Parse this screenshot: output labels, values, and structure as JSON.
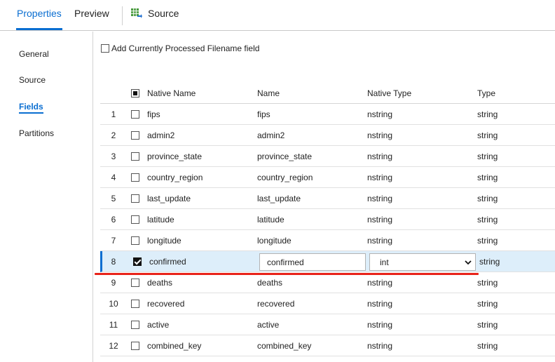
{
  "tabs": {
    "properties": "Properties",
    "preview": "Preview",
    "source": "Source"
  },
  "nav": {
    "general": "General",
    "source": "Source",
    "fields": "Fields",
    "partitions": "Partitions"
  },
  "add_filename_label": "Add Currently Processed Filename field",
  "columns": {
    "native_name": "Native Name",
    "name": "Name",
    "native_type": "Native Type",
    "type": "Type"
  },
  "rows": [
    {
      "num": "1",
      "native_name": "fips",
      "name": "fips",
      "native_type": "nstring",
      "type": "string"
    },
    {
      "num": "2",
      "native_name": "admin2",
      "name": "admin2",
      "native_type": "nstring",
      "type": "string"
    },
    {
      "num": "3",
      "native_name": "province_state",
      "name": "province_state",
      "native_type": "nstring",
      "type": "string"
    },
    {
      "num": "4",
      "native_name": "country_region",
      "name": "country_region",
      "native_type": "nstring",
      "type": "string"
    },
    {
      "num": "5",
      "native_name": "last_update",
      "name": "last_update",
      "native_type": "nstring",
      "type": "string"
    },
    {
      "num": "6",
      "native_name": "latitude",
      "name": "latitude",
      "native_type": "nstring",
      "type": "string"
    },
    {
      "num": "7",
      "native_name": "longitude",
      "name": "longitude",
      "native_type": "nstring",
      "type": "string"
    },
    {
      "num": "8",
      "native_name": "confirmed",
      "name": "confirmed",
      "native_type": "int",
      "type": "string"
    },
    {
      "num": "9",
      "native_name": "deaths",
      "name": "deaths",
      "native_type": "nstring",
      "type": "string"
    },
    {
      "num": "10",
      "native_name": "recovered",
      "name": "recovered",
      "native_type": "nstring",
      "type": "string"
    },
    {
      "num": "11",
      "native_name": "active",
      "name": "active",
      "native_type": "nstring",
      "type": "string"
    },
    {
      "num": "12",
      "native_name": "combined_key",
      "name": "combined_key",
      "native_type": "nstring",
      "type": "string"
    }
  ],
  "colors": {
    "accent": "#0a6ed1",
    "selected_row": "#ddeefa",
    "highlight_line": "#e8231a"
  }
}
